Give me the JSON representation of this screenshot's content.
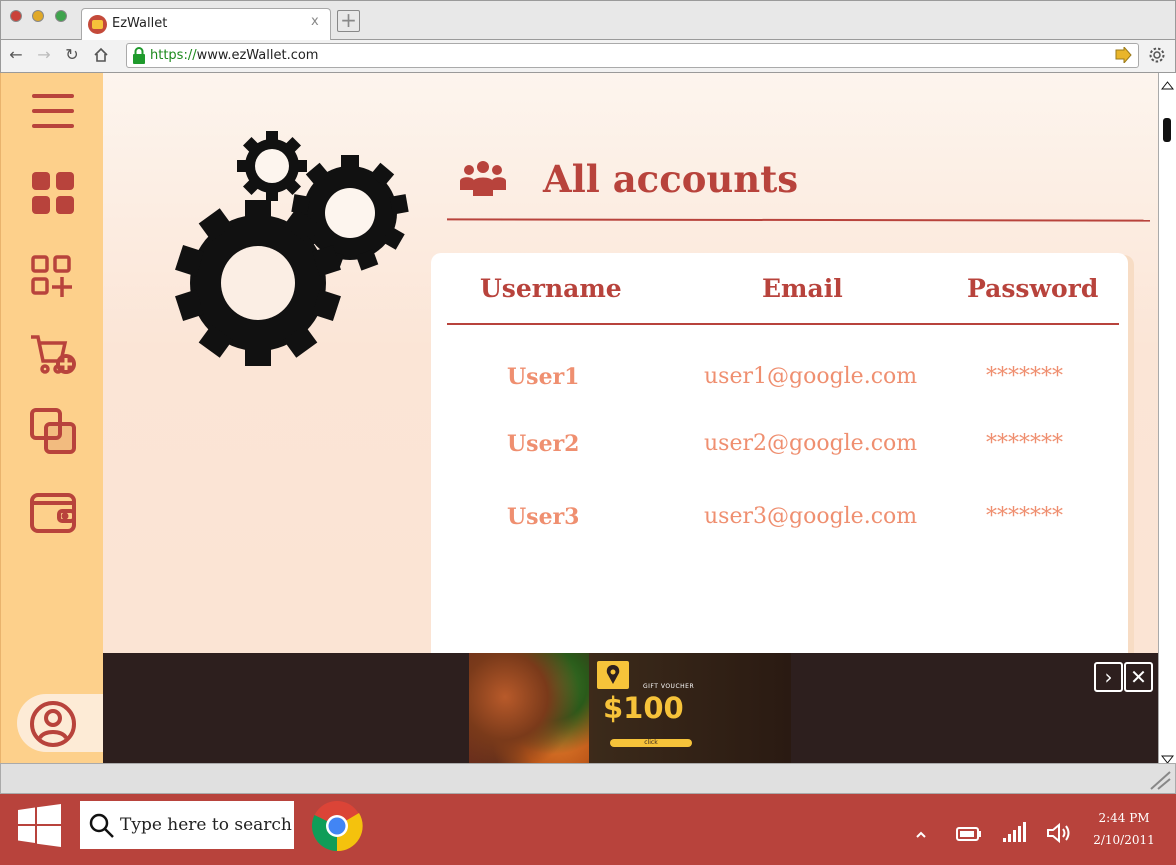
{
  "browser": {
    "tab_title": "EzWallet",
    "tab_close": "x",
    "url_protocol": "https://",
    "url_host": "www.ezWallet.com"
  },
  "sidebar": {
    "items": [
      {
        "icon": "menu-icon"
      },
      {
        "icon": "dashboard-icon"
      },
      {
        "icon": "add-category-icon"
      },
      {
        "icon": "cart-add-icon"
      },
      {
        "icon": "transactions-icon"
      },
      {
        "icon": "wallet-icon"
      }
    ],
    "profile_icon": "user-icon"
  },
  "main": {
    "title": "All accounts",
    "title_icon": "group-icon",
    "table": {
      "columns": [
        "Username",
        "Email",
        "Password"
      ],
      "rows": [
        {
          "username": "User1",
          "email": "user1@google.com",
          "password": "*******"
        },
        {
          "username": "User2",
          "email": "user2@google.com",
          "password": "*******"
        },
        {
          "username": "User3",
          "email": "user3@google.com",
          "password": "*******"
        }
      ]
    }
  },
  "ad": {
    "voucher_label": "GIFT VOUCHER",
    "amount": "$100",
    "cta": "click"
  },
  "taskbar": {
    "search_placeholder": "Type here to search",
    "time": "2:44 PM",
    "date": "2/10/2011"
  },
  "colors": {
    "accent": "#b8433c",
    "sidebar": "#fdd08b",
    "cell_text": "#ef8f70",
    "voucher_yellow": "#f6c33a"
  }
}
